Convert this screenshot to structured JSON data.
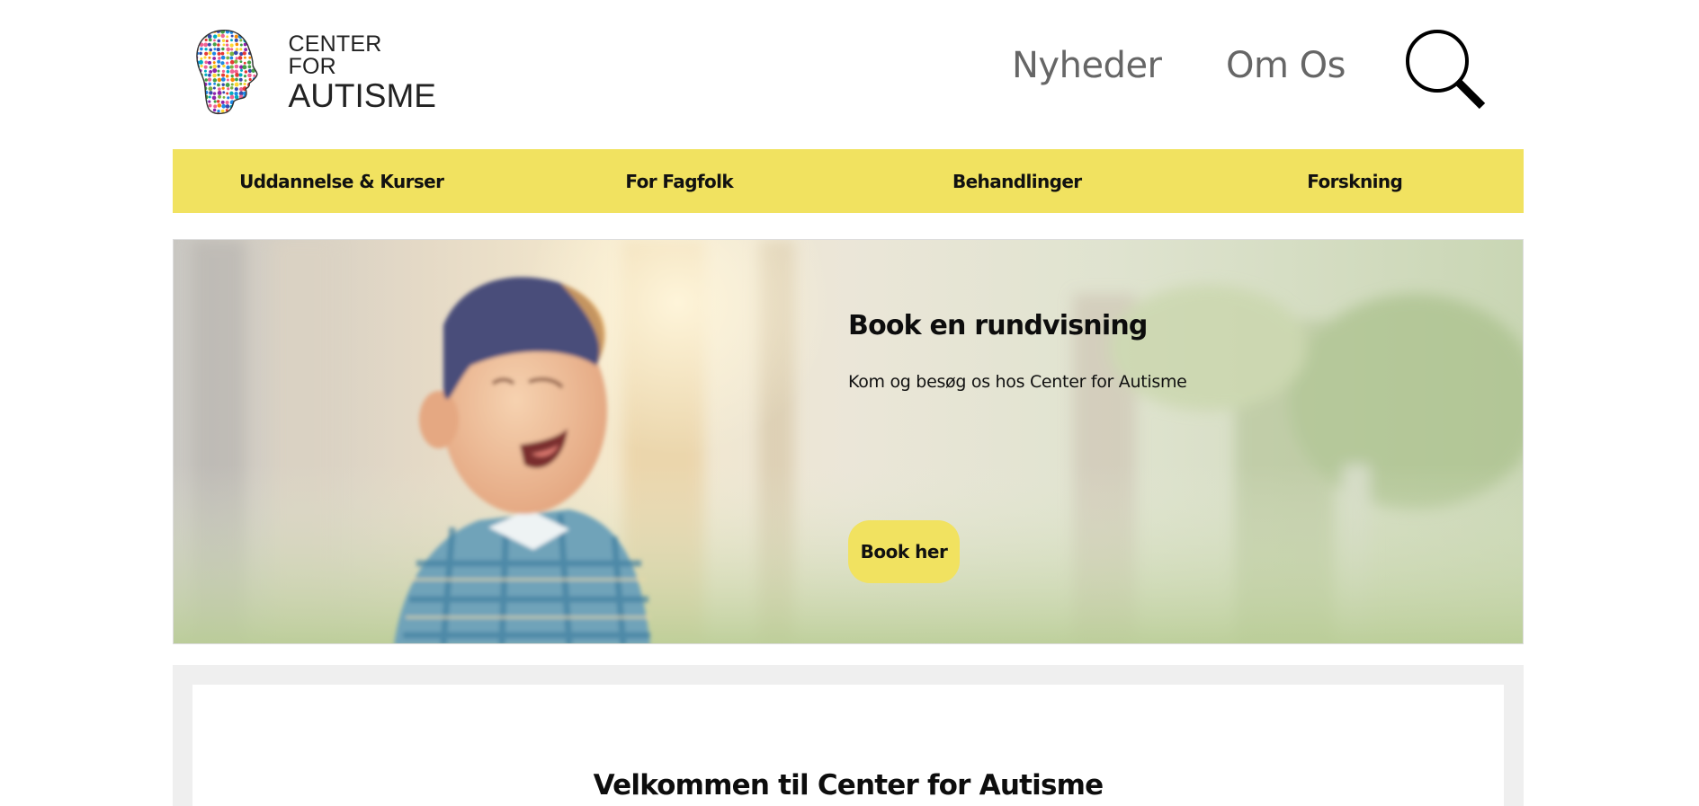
{
  "logo": {
    "line1": "CENTER FOR",
    "line2": "AUTISME",
    "icon": "colorful-dotted-head-icon"
  },
  "top_nav": {
    "news": "Nyheder",
    "about": "Om Os",
    "search_icon": "search-icon"
  },
  "main_nav": {
    "items": [
      {
        "label": "Uddannelse & Kurser"
      },
      {
        "label": "For Fagfolk"
      },
      {
        "label": "Behandlinger"
      },
      {
        "label": "Forskning"
      }
    ]
  },
  "hero": {
    "title": "Book en rundvisning",
    "text": "Kom og besøg os hos Center for Autisme",
    "button_label": "Book her",
    "image": "laughing-child-photo"
  },
  "welcome": {
    "title": "Velkommen til Center for Autisme"
  },
  "colors": {
    "accent_yellow": "#f1e260",
    "nav_grey": "#666666",
    "section_grey": "#efefef"
  }
}
